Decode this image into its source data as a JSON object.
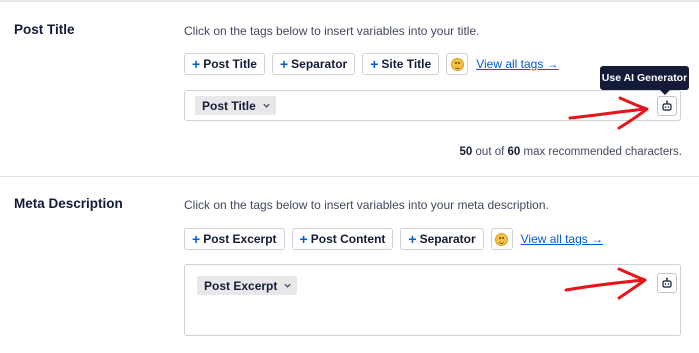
{
  "post_title": {
    "label": "Post Title",
    "instruction": "Click on the tags below to insert variables into your title.",
    "tags": [
      "Post Title",
      "Separator",
      "Site Title"
    ],
    "view_all": "View all tags →",
    "editor_tag": "Post Title",
    "ai_tooltip": "Use AI Generator",
    "char_count": {
      "current": "50",
      "middle": " out of ",
      "max": "60",
      "suffix": " max recommended characters."
    }
  },
  "meta_description": {
    "label": "Meta Description",
    "instruction": "Click on the tags below to insert variables into your meta description.",
    "tags": [
      "Post Excerpt",
      "Post Content",
      "Separator"
    ],
    "view_all": "View all tags →",
    "editor_tag": "Post Excerpt"
  },
  "colors": {
    "accent": "#005ae0",
    "annotation_arrow": "#e8141c",
    "tooltip_bg": "#141b38"
  },
  "icons": [
    "plus-icon",
    "emoji-icon",
    "chevron-down-icon",
    "robot-icon",
    "arrow-annotation"
  ]
}
